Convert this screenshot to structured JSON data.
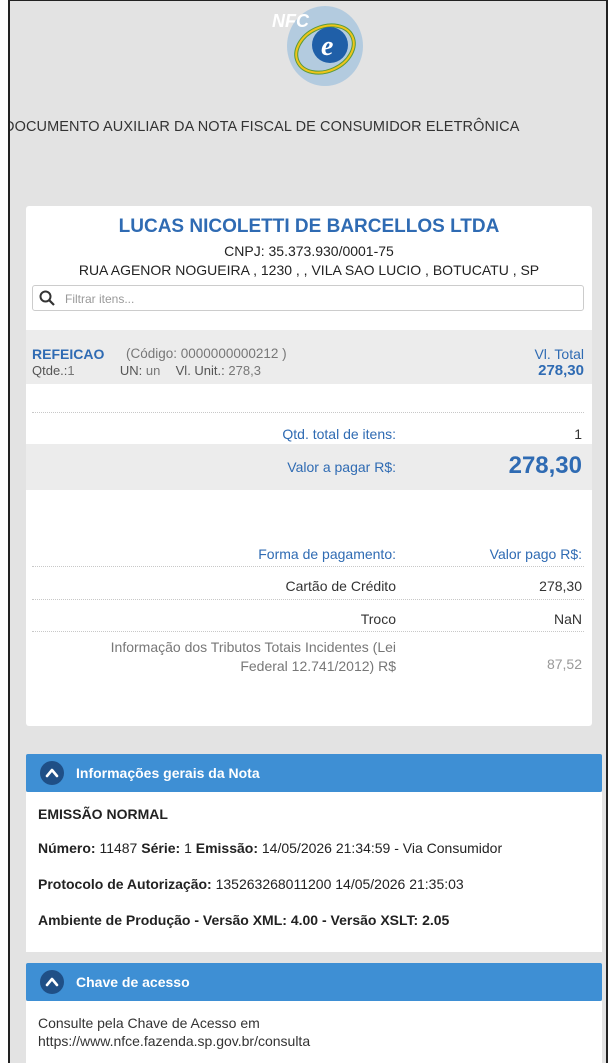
{
  "header": {
    "doc_title": "DOCUMENTO AUXILIAR DA NOTA FISCAL DE CONSUMIDOR ELETRÔNICA",
    "logo_text": "NFC"
  },
  "company": {
    "name": "LUCAS NICOLETTI DE BARCELLOS LTDA",
    "cnpj": "CNPJ: 35.373.930/0001-75",
    "address": "RUA AGENOR NOGUEIRA , 1230 , , VILA SAO LUCIO , BOTUCATU , SP"
  },
  "search": {
    "placeholder": "Filtrar itens..."
  },
  "item": {
    "name": "REFEICAO",
    "code": "(Código: 0000000000212 )",
    "qty_label": "Qtde.:",
    "qty_value": "1",
    "un_label": "UN:",
    "un_value": "un",
    "unit_label": "Vl. Unit.:",
    "unit_value": "278,3",
    "total_label": "Vl. Total",
    "total_value": "278,30"
  },
  "totals": {
    "qtd_label": "Qtd. total de itens:",
    "qtd_value": "1",
    "pagar_label": "Valor a pagar R$:",
    "pagar_value": "278,30"
  },
  "payment": {
    "forma_label": "Forma de pagamento:",
    "pago_label": "Valor pago R$:",
    "method": "Cartão de Crédito",
    "method_value": "278,30",
    "troco_label": "Troco",
    "troco_value": "NaN"
  },
  "tributos": {
    "line1": "Informação dos Tributos Totais Incidentes (Lei",
    "line2": "Federal 12.741/2012) R$",
    "value": "87,52"
  },
  "info_panel": {
    "title": "Informações gerais da Nota",
    "emissao_tipo": "EMISSÃO NORMAL",
    "numero_label": "Número:",
    "numero": "11487",
    "serie_label": "Série:",
    "serie": "1",
    "emissao_label": "Emissão:",
    "emissao": "14/05/2026 21:34:59 - Via Consumidor",
    "protocolo_label": "Protocolo de Autorização:",
    "protocolo": "135263268011200 14/05/2026 21:35:03",
    "ambiente": "Ambiente de Produção - Versão XML: 4.00 - Versão XSLT: 2.05"
  },
  "chave_panel": {
    "title": "Chave de acesso",
    "line1": "Consulte pela Chave de Acesso em",
    "line2": "https://www.nfce.fazenda.sp.gov.br/consulta"
  },
  "colors": {
    "accent": "#2f6bb3",
    "panel_header": "#3e8fd4",
    "background": "#e3e3e3"
  }
}
